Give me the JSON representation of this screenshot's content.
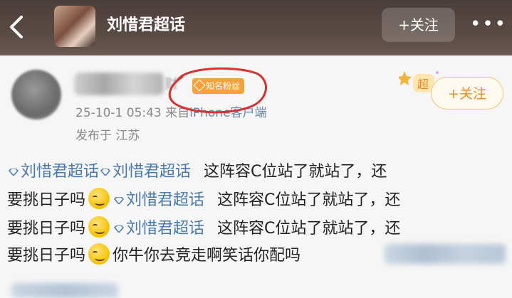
{
  "header": {
    "title": "刘惜君超话",
    "follow_label": "+关注",
    "more_label": "•••",
    "back_icon": "chevron-left-icon"
  },
  "post": {
    "badge_label": "知名粉丝",
    "username_suffix": "财",
    "time": "25-10-1 05:43",
    "source_prefix": "来自",
    "source": "iPhone客户端",
    "location": "发布于 江苏",
    "super_label": "超",
    "follow_label": "+关注",
    "tag": "刘惜君超话",
    "text_repeat": "这阵容C位站了就站了，还",
    "text_continue": "要挑日子吗",
    "text_end": "你牛你去竞走啊笑话你配吗"
  },
  "colors": {
    "header_bg": "#4a3e3a",
    "tag": "#4a79b0",
    "follow_accent": "#f08a1a",
    "badge": "#f3a33a",
    "annotation_circle": "#d93030"
  }
}
